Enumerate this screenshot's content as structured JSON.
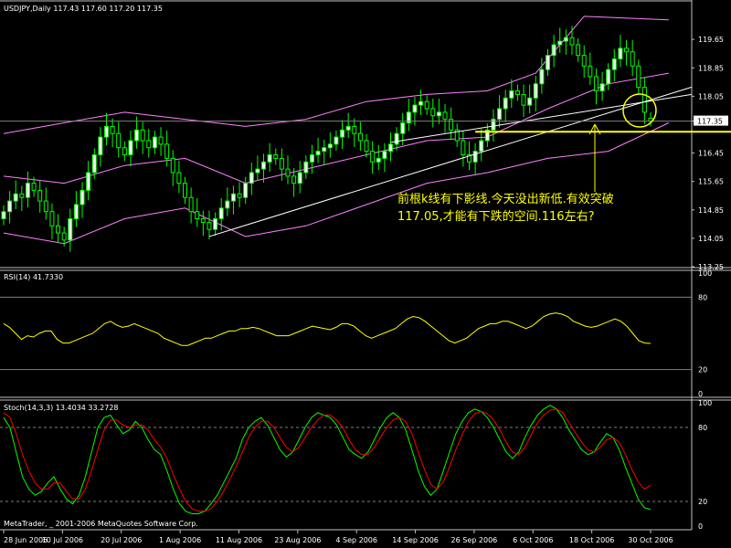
{
  "header": {
    "main": "USDJPY,Daily  117.43 117.60 117.20 117.35",
    "rsi": "RSI(14) 41.7330",
    "stoch": "Stoch(14,3,3) 13.4034 33.2728"
  },
  "copyright": "MetaTrader, _ 2001-2006 MetaQuotes Software Corp.",
  "annotation": {
    "line1": "前根k线有下影线.今天没出新低.有效突破",
    "line2": "117.05,才能有下跌的空间.116左右?"
  },
  "price_tag": "117.35",
  "colors": {
    "background": "#000000",
    "grid": "#808080",
    "candle": "#00ff00",
    "bollinger": "#ff80ff",
    "rsi": "#ffff00",
    "stoch_main": "#00ff00",
    "stoch_signal": "#ff0000",
    "annotation": "#ffff00",
    "trendline": "#ffffff"
  },
  "chart_data": [
    {
      "type": "candlestick",
      "title": "USDJPY,Daily",
      "yticks": [
        "119.65",
        "118.85",
        "118.05",
        "117.35",
        "116.45",
        "115.65",
        "114.85",
        "114.05",
        "113.25"
      ],
      "ylim": [
        113.25,
        120.4
      ],
      "xticks": [
        "28 Jun 2006",
        "10 Jul 2006",
        "20 Jul 2006",
        "1 Aug 2006",
        "11 Aug 2006",
        "23 Aug 2006",
        "4 Sep 2006",
        "14 Sep 2006",
        "26 Sep 2006",
        "6 Oct 2006",
        "18 Oct 2006",
        "30 Oct 2006"
      ],
      "last_bar": {
        "open": 117.43,
        "high": 117.6,
        "low": 117.2,
        "close": 117.35
      },
      "horizontal_line": 117.05,
      "closes": [
        114.8,
        115.1,
        115.3,
        115.2,
        115.6,
        115.4,
        115.1,
        114.8,
        114.4,
        114.2,
        114.0,
        114.6,
        115.0,
        115.4,
        115.9,
        116.4,
        116.9,
        117.2,
        117.0,
        116.6,
        116.4,
        116.8,
        117.1,
        116.8,
        116.6,
        116.9,
        116.7,
        116.3,
        115.9,
        115.6,
        115.2,
        114.8,
        114.6,
        114.5,
        114.3,
        114.6,
        114.9,
        115.1,
        115.3,
        115.2,
        115.6,
        115.9,
        116.0,
        116.2,
        116.4,
        116.3,
        116.0,
        115.8,
        115.6,
        115.9,
        116.2,
        116.4,
        116.5,
        116.6,
        116.7,
        116.9,
        117.1,
        117.2,
        117.0,
        116.8,
        116.5,
        116.2,
        116.3,
        116.5,
        116.7,
        117.0,
        117.3,
        117.6,
        117.8,
        117.9,
        117.7,
        117.5,
        117.6,
        117.4,
        117.1,
        116.8,
        116.4,
        116.2,
        116.5,
        116.8,
        117.1,
        117.4,
        117.7,
        118.0,
        118.2,
        118.1,
        117.8,
        118.0,
        118.4,
        118.8,
        119.2,
        119.5,
        119.6,
        119.7,
        119.5,
        119.2,
        118.9,
        118.6,
        118.2,
        118.4,
        118.8,
        119.1,
        119.4,
        119.3,
        118.9,
        118.3,
        117.6,
        117.35
      ],
      "bollinger": {
        "upper": [
          [
            0,
            117.0
          ],
          [
            10,
            117.3
          ],
          [
            20,
            117.6
          ],
          [
            30,
            117.4
          ],
          [
            40,
            117.2
          ],
          [
            50,
            117.4
          ],
          [
            60,
            117.9
          ],
          [
            70,
            118.1
          ],
          [
            80,
            118.2
          ],
          [
            88,
            118.7
          ],
          [
            96,
            120.3
          ],
          [
            110,
            120.2
          ]
        ],
        "middle": [
          [
            0,
            115.8
          ],
          [
            10,
            115.6
          ],
          [
            20,
            116.1
          ],
          [
            30,
            116.3
          ],
          [
            40,
            115.6
          ],
          [
            50,
            116.0
          ],
          [
            60,
            116.4
          ],
          [
            70,
            116.8
          ],
          [
            80,
            116.9
          ],
          [
            90,
            117.7
          ],
          [
            100,
            118.4
          ],
          [
            110,
            118.7
          ]
        ],
        "lower": [
          [
            0,
            114.2
          ],
          [
            10,
            113.9
          ],
          [
            20,
            114.6
          ],
          [
            30,
            114.9
          ],
          [
            40,
            114.1
          ],
          [
            50,
            114.4
          ],
          [
            60,
            115.0
          ],
          [
            70,
            115.6
          ],
          [
            80,
            115.9
          ],
          [
            90,
            116.3
          ],
          [
            100,
            116.5
          ],
          [
            110,
            117.3
          ]
        ]
      },
      "trendline": [
        [
          34,
          114.1
        ],
        [
          110,
          118.05
        ]
      ]
    },
    {
      "type": "line",
      "title": "RSI(14) 41.7330",
      "yticks": [
        "100",
        "80",
        "20",
        "0"
      ],
      "ylim": [
        0,
        100
      ],
      "levels": [
        80,
        20
      ],
      "values": [
        58,
        55,
        50,
        45,
        48,
        47,
        50,
        52,
        52,
        45,
        42,
        42,
        44,
        46,
        48,
        50,
        54,
        58,
        60,
        57,
        55,
        56,
        58,
        56,
        54,
        52,
        50,
        46,
        44,
        42,
        40,
        40,
        42,
        44,
        46,
        46,
        48,
        50,
        52,
        52,
        54,
        54,
        55,
        54,
        52,
        50,
        48,
        48,
        48,
        50,
        52,
        54,
        56,
        55,
        54,
        53,
        55,
        58,
        58,
        56,
        52,
        48,
        46,
        48,
        50,
        52,
        54,
        58,
        62,
        64,
        63,
        60,
        56,
        52,
        48,
        44,
        42,
        44,
        46,
        50,
        54,
        56,
        58,
        58,
        60,
        60,
        58,
        56,
        54,
        56,
        60,
        64,
        66,
        67,
        66,
        64,
        60,
        58,
        56,
        55,
        56,
        58,
        60,
        62,
        60,
        56,
        50,
        44,
        42,
        41.7
      ]
    },
    {
      "type": "line",
      "title": "Stoch(14,3,3) 13.4034 33.2728",
      "yticks": [
        "100",
        "80",
        "20",
        "0"
      ],
      "ylim": [
        0,
        100
      ],
      "levels": [
        80,
        20
      ],
      "series": [
        {
          "name": "main",
          "values": [
            88,
            80,
            60,
            40,
            30,
            25,
            28,
            35,
            40,
            30,
            22,
            18,
            25,
            40,
            60,
            80,
            88,
            90,
            82,
            75,
            78,
            85,
            80,
            70,
            62,
            58,
            45,
            30,
            18,
            12,
            10,
            10,
            12,
            18,
            25,
            35,
            45,
            55,
            70,
            80,
            85,
            88,
            82,
            72,
            62,
            56,
            60,
            70,
            80,
            88,
            92,
            90,
            88,
            82,
            72,
            62,
            58,
            55,
            60,
            70,
            80,
            88,
            92,
            88,
            78,
            62,
            45,
            32,
            25,
            30,
            45,
            60,
            75,
            85,
            92,
            95,
            93,
            88,
            80,
            70,
            60,
            55,
            60,
            72,
            82,
            90,
            95,
            98,
            95,
            88,
            78,
            70,
            62,
            58,
            60,
            68,
            75,
            72,
            62,
            48,
            35,
            22,
            15,
            13.4
          ]
        },
        {
          "name": "signal",
          "values": [
            92,
            88,
            75,
            58,
            45,
            35,
            30,
            30,
            35,
            35,
            28,
            22,
            22,
            30,
            45,
            62,
            78,
            86,
            86,
            82,
            80,
            82,
            82,
            78,
            70,
            64,
            55,
            42,
            30,
            20,
            14,
            12,
            12,
            14,
            20,
            28,
            38,
            48,
            60,
            72,
            80,
            85,
            85,
            80,
            72,
            64,
            60,
            64,
            72,
            80,
            86,
            90,
            90,
            86,
            80,
            70,
            62,
            58,
            58,
            64,
            72,
            80,
            86,
            88,
            85,
            75,
            60,
            46,
            34,
            30,
            36,
            48,
            62,
            74,
            85,
            91,
            93,
            91,
            86,
            78,
            68,
            60,
            58,
            64,
            74,
            84,
            90,
            94,
            95,
            92,
            84,
            76,
            68,
            62,
            60,
            64,
            70,
            72,
            68,
            58,
            46,
            36,
            30,
            33.3
          ]
        }
      ]
    }
  ]
}
